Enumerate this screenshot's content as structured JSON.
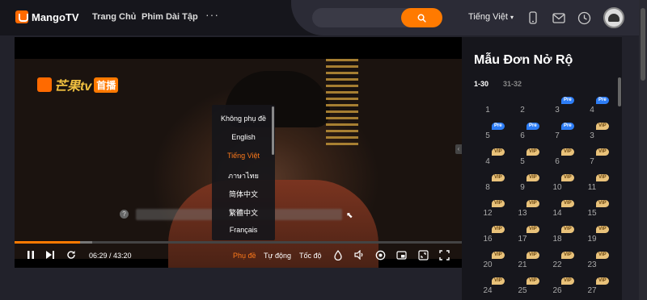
{
  "header": {
    "logo_text": "MangoTV",
    "nav": [
      {
        "label": "Trang Chủ"
      },
      {
        "label": "Phim Dài Tập"
      }
    ],
    "more": "···",
    "search_placeholder": "",
    "language": "Tiếng Việt",
    "language_caret": "▾",
    "icons": [
      "phone-icon",
      "mail-icon",
      "history-icon"
    ]
  },
  "player": {
    "watermark_text": "芒果tv",
    "watermark_badge": "首播",
    "subtitle_menu": {
      "items": [
        "Không phụ đề",
        "English",
        "Tiếng Việt",
        "ภาษาไทย",
        "简体中文",
        "繁體中文",
        "Français"
      ],
      "active": "Tiếng Việt"
    },
    "progress_fraction": 0.146,
    "time": "06:29 / 43:20",
    "controls": {
      "subtitle": "Phụ đề",
      "auto": "Tự động",
      "speed": "Tốc độ"
    },
    "help_mark": "?"
  },
  "episodes": {
    "title": "Mẫu Đơn Nở Rộ",
    "ranges": [
      "1-30",
      "31-32"
    ],
    "active_range": "1-30",
    "rows": [
      [
        {
          "n": "1",
          "badge": ""
        },
        {
          "n": "2",
          "badge": ""
        },
        {
          "n": "3",
          "badge": "Pre"
        },
        {
          "n": "4",
          "badge": "Pre"
        }
      ],
      [
        {
          "n": "5",
          "badge": "Pre"
        },
        {
          "n": "6",
          "badge": "Pre"
        },
        {
          "n": "7",
          "badge": "Pre"
        },
        {
          "n": "3",
          "badge": "VIP"
        }
      ],
      [
        {
          "n": "4",
          "badge": "VIP"
        },
        {
          "n": "5",
          "badge": "VIP"
        },
        {
          "n": "6",
          "badge": "VIP"
        },
        {
          "n": "7",
          "badge": "VIP"
        }
      ],
      [
        {
          "n": "8",
          "badge": "VIP"
        },
        {
          "n": "9",
          "badge": "VIP"
        },
        {
          "n": "10",
          "badge": "VIP"
        },
        {
          "n": "11",
          "badge": "VIP"
        }
      ],
      [
        {
          "n": "12",
          "badge": "VIP"
        },
        {
          "n": "13",
          "badge": "VIP"
        },
        {
          "n": "14",
          "badge": "VIP"
        },
        {
          "n": "15",
          "badge": "VIP"
        }
      ],
      [
        {
          "n": "16",
          "badge": "VIP"
        },
        {
          "n": "17",
          "badge": "VIP"
        },
        {
          "n": "18",
          "badge": "VIP"
        },
        {
          "n": "19",
          "badge": "VIP"
        }
      ],
      [
        {
          "n": "20",
          "badge": "VIP"
        },
        {
          "n": "21",
          "badge": "VIP"
        },
        {
          "n": "22",
          "badge": "VIP"
        },
        {
          "n": "23",
          "badge": "VIP"
        }
      ],
      [
        {
          "n": "24",
          "badge": "VIP"
        },
        {
          "n": "25",
          "badge": "VIP"
        },
        {
          "n": "26",
          "badge": "VIP"
        },
        {
          "n": "27",
          "badge": "VIP"
        }
      ]
    ]
  },
  "colors": {
    "accent": "#ff7a00",
    "pre_badge": "#2d7df6",
    "vip_badge": "#e9c27a"
  }
}
